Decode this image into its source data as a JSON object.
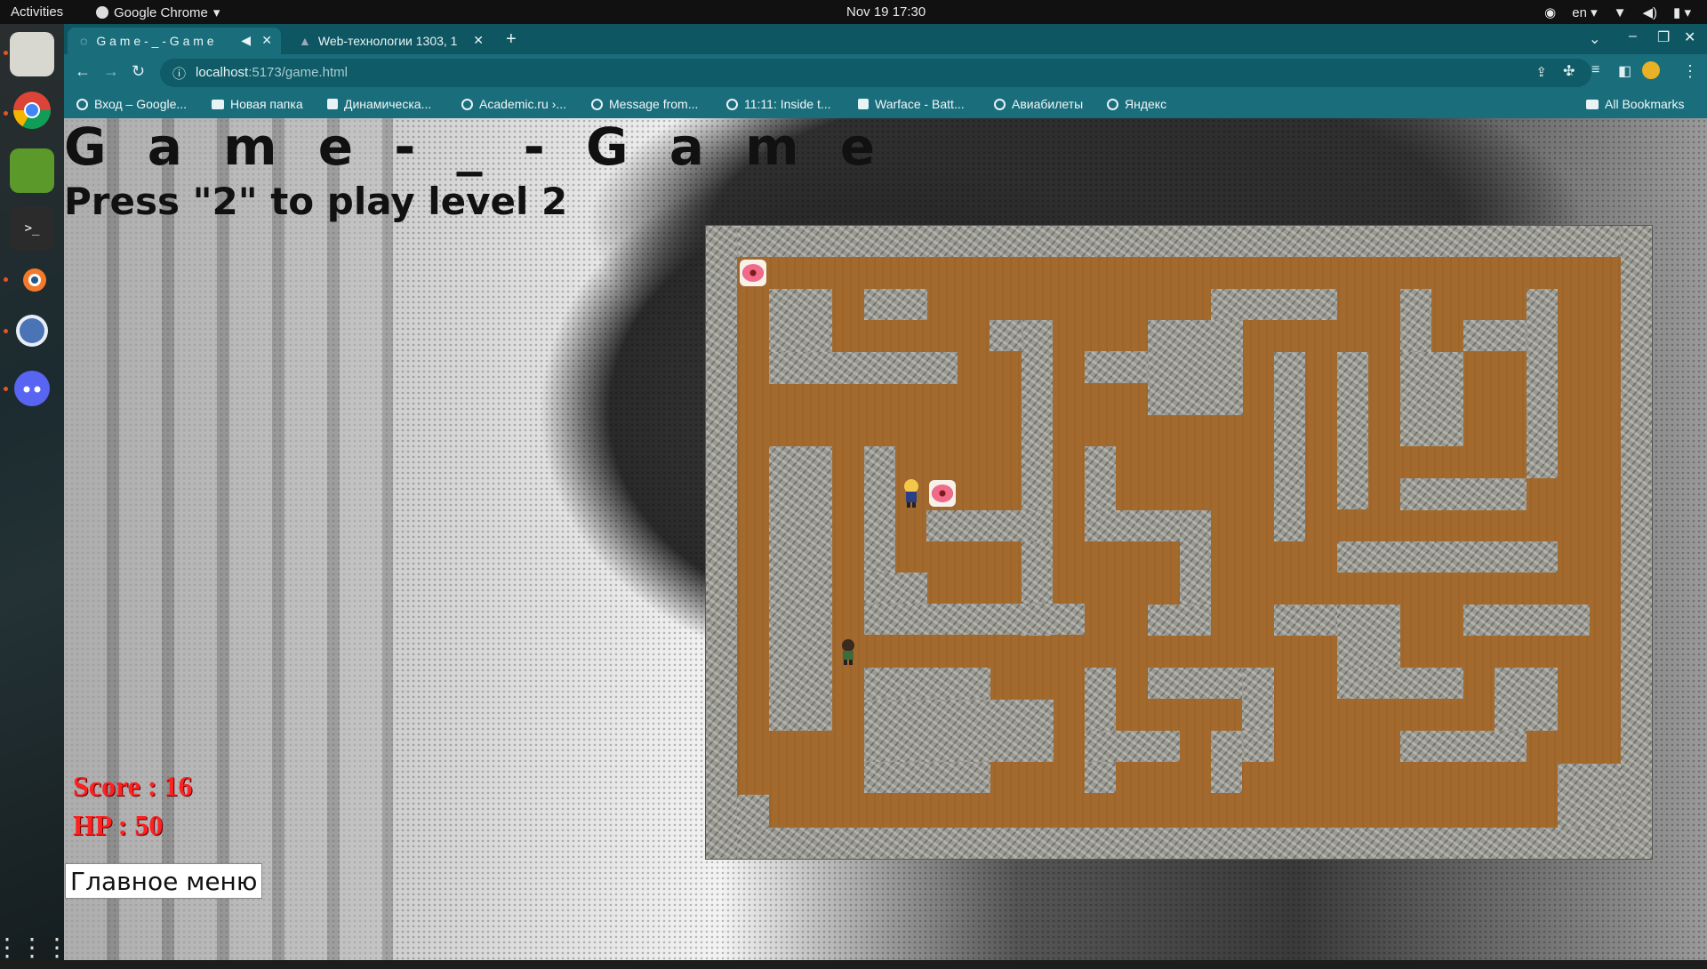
{
  "os": {
    "activities": "Activities",
    "app_name": "Google Chrome",
    "clock": "Nov 19  17:30",
    "lang": "en"
  },
  "browser": {
    "tabs": [
      {
        "label": "G a m e - _ - G a m e",
        "active": true
      },
      {
        "label": "Web-технологии 1303, 1",
        "active": false
      }
    ],
    "url_host": "localhost",
    "url_path": ":5173/game.html",
    "bookmarks": [
      "Вход – Google...",
      "Новая папка",
      "Динамическа...",
      "Academic.ru ›...",
      "Message from...",
      "11:11: Inside t...",
      "Warface - Batt...",
      "Авиабилеты",
      "Яндекс"
    ],
    "all_bookmarks": "All Bookmarks"
  },
  "game": {
    "title": "G a m e - _ - G a m e",
    "subtitle": "Press \"2\" to play level 2",
    "score_text": "Score : 16",
    "hp_text": "HP : 50",
    "main_menu_button": "Главное меню"
  },
  "colors": {
    "floor": "#a46a2d",
    "wall": "#9a9a92",
    "score": "#ff2020",
    "tab_strip": "#0e5662",
    "toolbar": "#1a6e7c"
  }
}
